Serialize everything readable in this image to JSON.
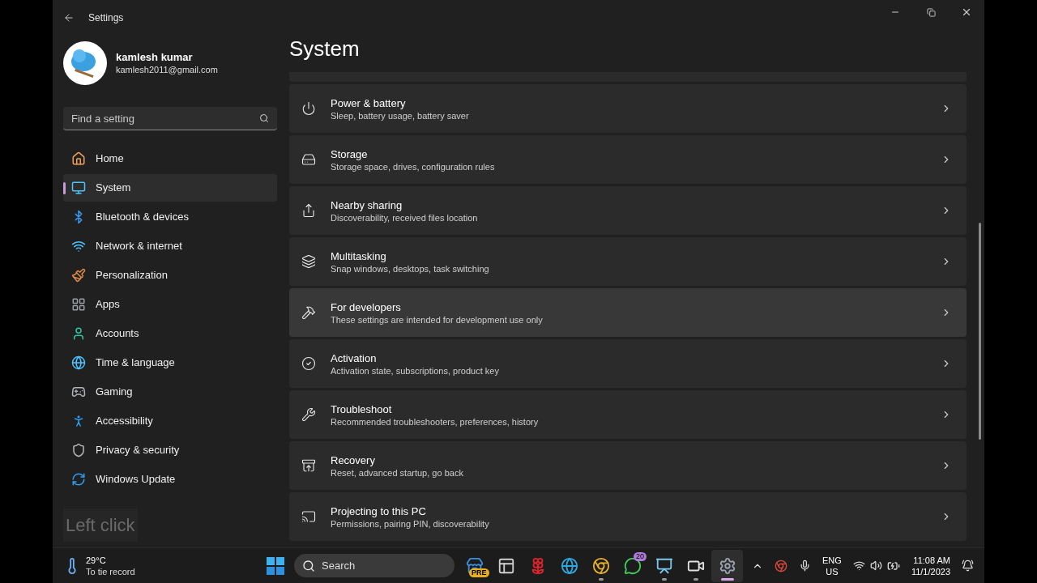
{
  "window": {
    "title": "Settings"
  },
  "user": {
    "name": "kamlesh kumar",
    "email": "kamlesh2011@gmail.com"
  },
  "search": {
    "placeholder": "Find a setting"
  },
  "nav": [
    {
      "label": "Home",
      "selected": false
    },
    {
      "label": "System",
      "selected": true
    },
    {
      "label": "Bluetooth & devices",
      "selected": false
    },
    {
      "label": "Network & internet",
      "selected": false
    },
    {
      "label": "Personalization",
      "selected": false
    },
    {
      "label": "Apps",
      "selected": false
    },
    {
      "label": "Accounts",
      "selected": false
    },
    {
      "label": "Time & language",
      "selected": false
    },
    {
      "label": "Gaming",
      "selected": false
    },
    {
      "label": "Accessibility",
      "selected": false
    },
    {
      "label": "Privacy & security",
      "selected": false
    },
    {
      "label": "Windows Update",
      "selected": false
    }
  ],
  "click_hint": "Left click",
  "page_title": "System",
  "settings": [
    {
      "title": "Power & battery",
      "subtitle": "Sleep, battery usage, battery saver",
      "hovered": false
    },
    {
      "title": "Storage",
      "subtitle": "Storage space, drives, configuration rules",
      "hovered": false
    },
    {
      "title": "Nearby sharing",
      "subtitle": "Discoverability, received files location",
      "hovered": false
    },
    {
      "title": "Multitasking",
      "subtitle": "Snap windows, desktops, task switching",
      "hovered": false
    },
    {
      "title": "For developers",
      "subtitle": "These settings are intended for development use only",
      "hovered": true
    },
    {
      "title": "Activation",
      "subtitle": "Activation state, subscriptions, product key",
      "hovered": false
    },
    {
      "title": "Troubleshoot",
      "subtitle": "Recommended troubleshooters, preferences, history",
      "hovered": false
    },
    {
      "title": "Recovery",
      "subtitle": "Reset, advanced startup, go back",
      "hovered": false
    },
    {
      "title": "Projecting to this PC",
      "subtitle": "Permissions, pairing PIN, discoverability",
      "hovered": false
    }
  ],
  "taskbar": {
    "weather": {
      "temperature": "29°C",
      "caption": "To tie record"
    },
    "search_placeholder": "Search",
    "apps": [
      {
        "badge": "PRE",
        "running": false,
        "selected": false
      },
      {
        "running": false,
        "selected": false
      },
      {
        "running": false,
        "selected": false
      },
      {
        "running": false,
        "selected": false
      },
      {
        "running": true,
        "selected": false
      },
      {
        "badge": "20",
        "running": false,
        "selected": false
      },
      {
        "running": true,
        "selected": false
      },
      {
        "running": true,
        "selected": false
      },
      {
        "running": true,
        "selected": true
      }
    ],
    "language": "ENG",
    "region": "US",
    "time": "11:08 AM",
    "date": "11/1/2023"
  }
}
